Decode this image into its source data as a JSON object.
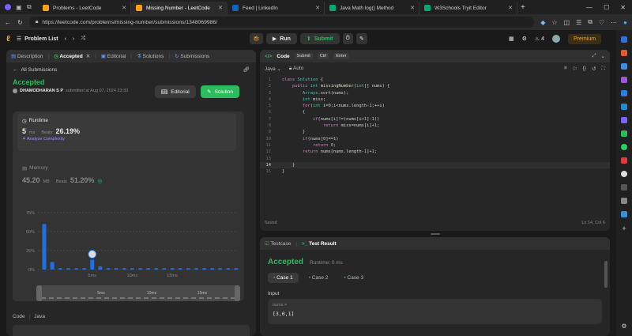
{
  "browser": {
    "tabs": [
      {
        "label": "Problems - LeetCode",
        "color": "#ffa116",
        "active": false
      },
      {
        "label": "Missing Number - LeetCode",
        "color": "#ffa116",
        "active": true
      },
      {
        "label": "Feed | LinkedIn",
        "color": "#0a66c2",
        "active": false
      },
      {
        "label": "Java Math log() Method",
        "color": "#04aa6d",
        "active": false
      },
      {
        "label": "W3Schools Tryit Editor",
        "color": "#04aa6d",
        "active": false
      }
    ],
    "url": "https://leetcode.com/problems/missing-number/submissions/1348069986/"
  },
  "nav": {
    "problem_list": "Problem List",
    "run": "Run",
    "submit": "Submit",
    "streak": "4",
    "premium": "Premium"
  },
  "left": {
    "tabs": [
      "Description",
      "Accepted",
      "Editorial",
      "Solutions",
      "Submissions"
    ],
    "all_submissions": "All Submissions",
    "status": "Accepted",
    "user": "DHAMODHARAN S P",
    "submitted": "submitted at Aug 07, 2024 23:33",
    "editorial_btn": "Editorial",
    "solution_btn": "Solution",
    "runtime": {
      "label": "Runtime",
      "value": "5",
      "unit": "ms",
      "beats_label": "Beats",
      "beats": "26.19%",
      "analyze": "Analyze Complexity"
    },
    "memory": {
      "label": "Memory",
      "value": "45.20",
      "unit": "MB",
      "beats_label": "Beats",
      "beats": "51.20%"
    },
    "code_label": "Code",
    "lang_label": "Java"
  },
  "chart_data": {
    "type": "bar",
    "y_ticks": [
      "75%",
      "50%",
      "25%",
      "0%"
    ],
    "x_ticks": [
      "5ms",
      "10ms",
      "15ms"
    ],
    "values": [
      60,
      10,
      2,
      2,
      2,
      2,
      13,
      4,
      2,
      2,
      2,
      2,
      2,
      2,
      2,
      2,
      2,
      2,
      2,
      2,
      2,
      2,
      2,
      2,
      2
    ],
    "highlight_index": 6,
    "ylim": [
      0,
      75
    ],
    "mini_ticks": [
      "5ms",
      "10ms",
      "15ms"
    ]
  },
  "editor": {
    "title": "Code",
    "kbd": [
      "Submit",
      "Ctrl",
      "Enter"
    ],
    "lang": "Java",
    "auto": "Auto",
    "saved": "Saved",
    "position": "Ln 14, Col 6",
    "lines": [
      "class Solution {",
      "    public int missingNumber(int[] nums) {",
      "        Arrays.sort(nums);",
      "        int miss;",
      "        for(int i=0;i<nums.length-1;++i)",
      "        {",
      "            if(nums[i]!=(nums[i+1]-1))",
      "                return miss=nums[i]+1;",
      "        }",
      "        if(nums[0]==1)",
      "            return 0;",
      "        return nums[nums.length-1]+1;",
      "",
      "    }",
      "}"
    ]
  },
  "result": {
    "testcase_tab": "Testcase",
    "result_tab": "Test Result",
    "status": "Accepted",
    "runtime": "Runtime: 0 ms",
    "cases": [
      "Case 1",
      "Case 2",
      "Case 3"
    ],
    "input_label": "Input",
    "param": "nums =",
    "value": "[3,0,1]"
  },
  "colors": {
    "accent": "#ffa116",
    "green": "#2cbb5d",
    "bar": "#1f6fe0"
  }
}
